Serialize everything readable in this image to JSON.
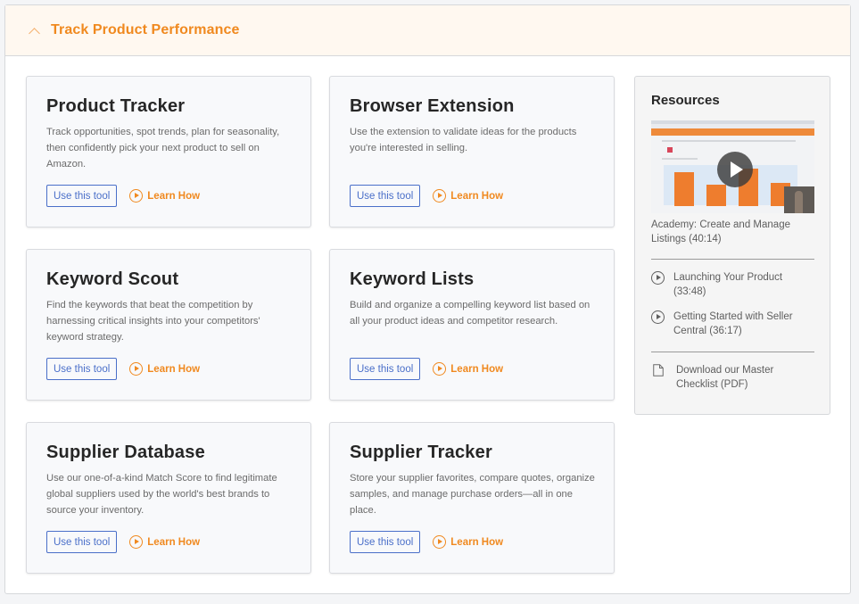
{
  "section": {
    "title": "Track Product Performance",
    "collapse_icon": "chevron-up-icon"
  },
  "tools": [
    {
      "title": "Product Tracker",
      "description": "Track opportunities, spot trends, plan for seasonality, then confidently pick your next product to sell on Amazon.",
      "use_label": "Use this tool",
      "learn_label": "Learn How"
    },
    {
      "title": "Browser Extension",
      "description": "Use the extension to validate ideas for the products you're interested in selling.",
      "use_label": "Use this tool",
      "learn_label": "Learn How"
    },
    {
      "title": "Keyword Scout",
      "description": "Find the keywords that beat the competition by harnessing critical insights into your competitors' keyword strategy.",
      "use_label": "Use this tool",
      "learn_label": "Learn How"
    },
    {
      "title": "Keyword Lists",
      "description": "Build and organize a compelling keyword list based on all your product ideas and competitor research.",
      "use_label": "Use this tool",
      "learn_label": "Learn How"
    },
    {
      "title": "Supplier Database",
      "description": "Use our one-of-a-kind Match Score to find legitimate global suppliers used by the world's best brands to source your inventory.",
      "use_label": "Use this tool",
      "learn_label": "Learn How"
    },
    {
      "title": "Supplier Tracker",
      "description": "Store your supplier favorites, compare quotes, organize samples, and manage purchase orders—all in one place.",
      "use_label": "Use this tool",
      "learn_label": "Learn How"
    }
  ],
  "resources": {
    "title": "Resources",
    "featured_video": {
      "label": "Academy: Create and Manage Listings (40:14)",
      "icon": "play-icon"
    },
    "videos": [
      {
        "label": "Launching Your Product (33:48)",
        "icon": "play-circle-icon"
      },
      {
        "label": "Getting Started with Seller Central (36:17)",
        "icon": "play-circle-icon"
      }
    ],
    "download": {
      "label": "Download our Master Checklist (PDF)",
      "icon": "document-icon"
    }
  },
  "colors": {
    "accent_orange": "#f0891f",
    "button_blue": "#4a6fc9",
    "header_bg": "#fff8f0"
  }
}
